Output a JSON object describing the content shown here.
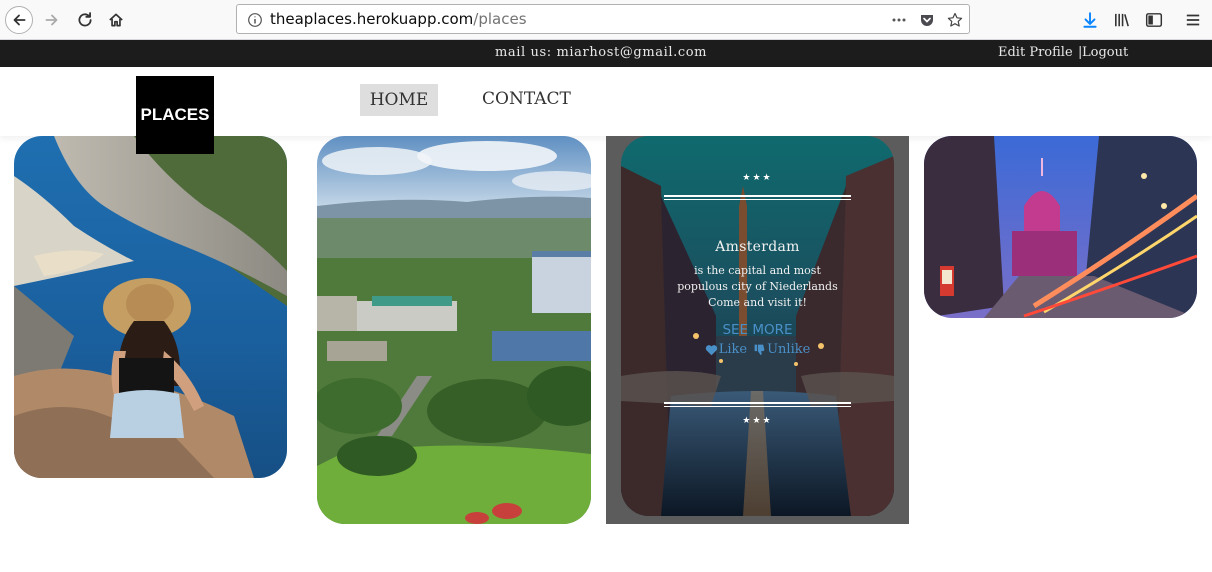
{
  "browser": {
    "url_host": "theaplaces.herokuapp.com",
    "url_path": "/places"
  },
  "topbar": {
    "mail": "mail us: miarhost@gmail.com",
    "edit_profile": "Edit Profile",
    "separator": "|",
    "logout": "Logout"
  },
  "header": {
    "logo": "PLACES",
    "nav": {
      "home": "HOME",
      "contact": "CONTACT"
    }
  },
  "cards": {
    "featured": {
      "stars_top": "★★★",
      "stars_bottom": "★★★",
      "title": "Amsterdam",
      "desc_1": "is the capital and most",
      "desc_2": "populous city of Niederlands",
      "desc_3": "Come and visit it!",
      "see_more": "SEE MORE",
      "like": "Like",
      "unlike": "Unlike"
    }
  },
  "colors": {
    "topbar_bg": "#1c1c1c",
    "nav_active_bg": "#dedede",
    "link_blue": "#4a90c8",
    "frame_gray": "#5c5c5c"
  },
  "icons": [
    "back-icon",
    "forward-icon",
    "reload-icon",
    "home-icon",
    "info-icon",
    "more-icon",
    "pocket-icon",
    "star-icon",
    "download-icon",
    "library-icon",
    "sidebar-icon",
    "menu-icon",
    "heart-icon",
    "thumbs-down-icon"
  ]
}
